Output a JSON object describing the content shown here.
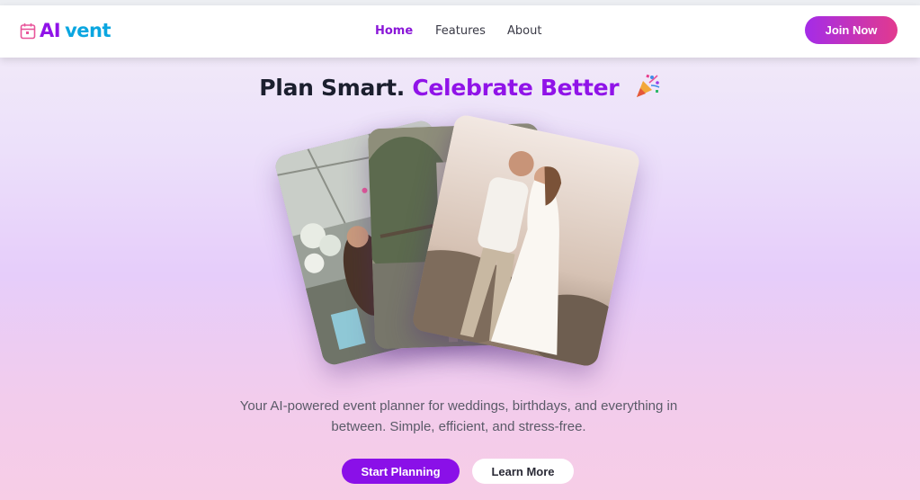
{
  "nav": {
    "logo_ai": "AI",
    "logo_vent": "vent",
    "links": [
      {
        "label": "Home",
        "active": true
      },
      {
        "label": "Features",
        "active": false
      },
      {
        "label": "About",
        "active": false
      }
    ],
    "join_label": "Join Now"
  },
  "hero": {
    "headline_part1": "Plan Smart.",
    "headline_part2": "Celebrate Better",
    "description": "Your AI-powered event planner for weddings, birthdays, and everything in between. Simple, efficient, and stress-free.",
    "primary_cta": "Start Planning",
    "secondary_cta": "Learn More"
  },
  "colors": {
    "brand_purple": "#9013e8",
    "brand_blue": "#0aa6e0",
    "gradient_start": "#a42ce8",
    "gradient_end": "#e23a8e"
  },
  "icons": [
    "calendar-icon",
    "party-popper-icon"
  ]
}
